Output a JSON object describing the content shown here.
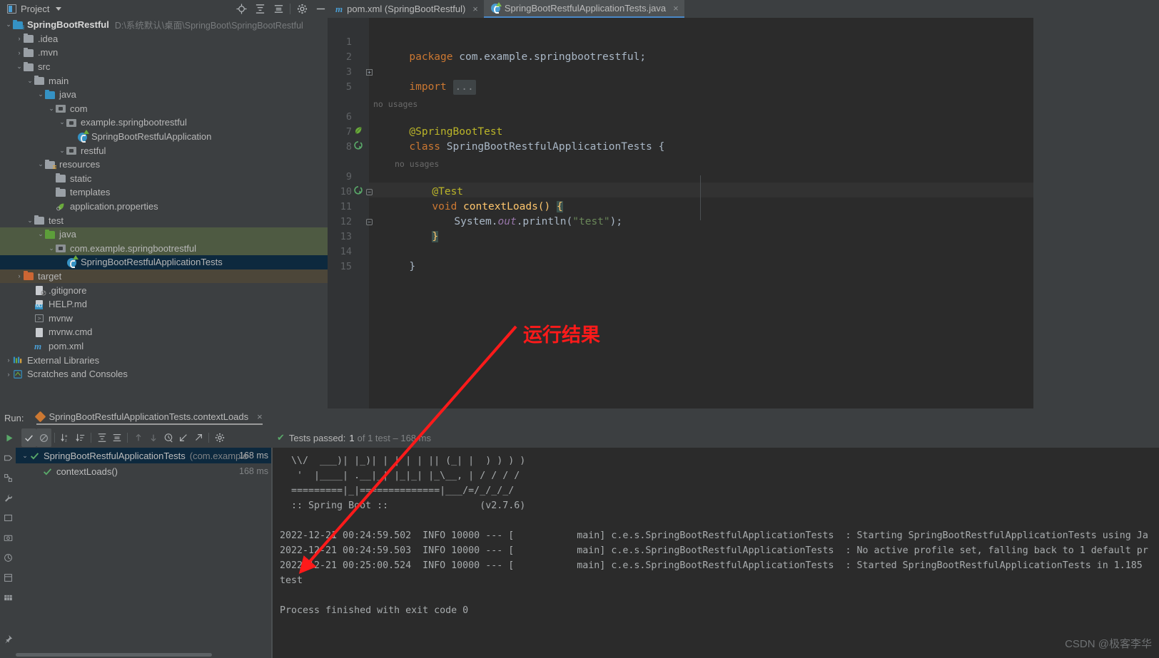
{
  "colors": {
    "accent_blue": "#4a88c7",
    "selection_blue": "#0d293e",
    "selection_green": "#4e5a42",
    "selection_brown": "#4c4639",
    "annotation_red": "#ff1a1a",
    "pass_green": "#59a869",
    "editor_bg": "#2b2b2b",
    "panel_bg": "#3c3f41"
  },
  "toolwindow": {
    "title": "Project",
    "icons": [
      "locate-icon",
      "expand-all-icon",
      "collapse-all-icon",
      "gear-icon",
      "minimize-icon"
    ]
  },
  "editor_tabs": [
    {
      "label": "pom.xml (SpringBootRestful)",
      "icon": "maven-icon",
      "active": false,
      "close": "×"
    },
    {
      "label": "SpringBootRestfulApplicationTests.java",
      "icon": "java-test-class-icon",
      "active": true,
      "close": "×"
    }
  ],
  "project_tree": [
    {
      "indent": 0,
      "arrow": "⌄",
      "icon": "module-folder-icon",
      "label": "SpringBootRestful",
      "path": "D:\\系统默认\\桌面\\SpringBoot\\SpringBootRestful",
      "bold": true,
      "select": "none"
    },
    {
      "indent": 1,
      "arrow": "›",
      "icon": "folder-icon",
      "label": ".idea",
      "path": "",
      "bold": false,
      "select": "none"
    },
    {
      "indent": 1,
      "arrow": "›",
      "icon": "folder-icon",
      "label": ".mvn",
      "path": "",
      "bold": false,
      "select": "none"
    },
    {
      "indent": 1,
      "arrow": "⌄",
      "icon": "folder-icon",
      "label": "src",
      "path": "",
      "bold": false,
      "select": "none"
    },
    {
      "indent": 2,
      "arrow": "⌄",
      "icon": "folder-icon",
      "label": "main",
      "path": "",
      "bold": false,
      "select": "none"
    },
    {
      "indent": 3,
      "arrow": "⌄",
      "icon": "source-folder-icon",
      "label": "java",
      "path": "",
      "bold": false,
      "select": "none"
    },
    {
      "indent": 4,
      "arrow": "⌄",
      "icon": "package-icon",
      "label": "com",
      "path": "",
      "bold": false,
      "select": "none"
    },
    {
      "indent": 5,
      "arrow": "⌄",
      "icon": "package-icon",
      "label": "example.springbootrestful",
      "path": "",
      "bold": false,
      "select": "none"
    },
    {
      "indent": 6,
      "arrow": "",
      "icon": "spring-class-icon",
      "label": "SpringBootRestfulApplication",
      "path": "",
      "bold": false,
      "select": "none"
    },
    {
      "indent": 5,
      "arrow": "⌄",
      "icon": "package-icon",
      "label": "restful",
      "path": "",
      "bold": false,
      "select": "none"
    },
    {
      "indent": 3,
      "arrow": "⌄",
      "icon": "resources-folder-icon",
      "label": "resources",
      "path": "",
      "bold": false,
      "select": "none"
    },
    {
      "indent": 4,
      "arrow": "",
      "icon": "folder-icon",
      "label": "static",
      "path": "",
      "bold": false,
      "select": "none"
    },
    {
      "indent": 4,
      "arrow": "",
      "icon": "folder-icon",
      "label": "templates",
      "path": "",
      "bold": false,
      "select": "none"
    },
    {
      "indent": 4,
      "arrow": "",
      "icon": "properties-file-icon",
      "label": "application.properties",
      "path": "",
      "bold": false,
      "select": "none"
    },
    {
      "indent": 2,
      "arrow": "⌄",
      "icon": "folder-icon",
      "label": "test",
      "path": "",
      "bold": false,
      "select": "none"
    },
    {
      "indent": 3,
      "arrow": "⌄",
      "icon": "test-source-folder-icon",
      "label": "java",
      "path": "",
      "bold": false,
      "select": "green"
    },
    {
      "indent": 4,
      "arrow": "⌄",
      "icon": "package-icon",
      "label": "com.example.springbootrestful",
      "path": "",
      "bold": false,
      "select": "green"
    },
    {
      "indent": 5,
      "arrow": "",
      "icon": "java-test-class-icon",
      "label": "SpringBootRestfulApplicationTests",
      "path": "",
      "bold": false,
      "select": "blue"
    },
    {
      "indent": 1,
      "arrow": "›",
      "icon": "excluded-folder-icon",
      "label": "target",
      "path": "",
      "bold": false,
      "select": "brown"
    },
    {
      "indent": 2,
      "arrow": "",
      "icon": "gitignore-file-icon",
      "label": ".gitignore",
      "path": "",
      "bold": false,
      "select": "none"
    },
    {
      "indent": 2,
      "arrow": "",
      "icon": "markdown-file-icon",
      "label": "HELP.md",
      "path": "",
      "bold": false,
      "select": "none"
    },
    {
      "indent": 2,
      "arrow": "",
      "icon": "shell-script-icon",
      "label": "mvnw",
      "path": "",
      "bold": false,
      "select": "none"
    },
    {
      "indent": 2,
      "arrow": "",
      "icon": "cmd-file-icon",
      "label": "mvnw.cmd",
      "path": "",
      "bold": false,
      "select": "none"
    },
    {
      "indent": 2,
      "arrow": "",
      "icon": "maven-icon",
      "label": "pom.xml",
      "path": "",
      "bold": false,
      "select": "none"
    },
    {
      "indent": 0,
      "arrow": "›",
      "icon": "external-libraries-icon",
      "label": "External Libraries",
      "path": "",
      "bold": false,
      "select": "none"
    },
    {
      "indent": 0,
      "arrow": "›",
      "icon": "scratches-icon",
      "label": "Scratches and Consoles",
      "path": "",
      "bold": false,
      "select": "none"
    }
  ],
  "code": {
    "lines": [
      {
        "num": "1",
        "gutter": "",
        "text": "package com.example.springbootrestful;"
      },
      {
        "num": "2",
        "gutter": "",
        "text": ""
      },
      {
        "num": "3",
        "gutter": "",
        "text": "import ..."
      },
      {
        "num": "5",
        "gutter": "",
        "text": ""
      },
      {
        "num": "",
        "gutter": "",
        "text": "no usages"
      },
      {
        "num": "6",
        "gutter": "spring-leaf-icon",
        "text": "@SpringBootTest"
      },
      {
        "num": "7",
        "gutter": "run-test-icon",
        "text": "class SpringBootRestfulApplicationTests {"
      },
      {
        "num": "8",
        "gutter": "",
        "text": ""
      },
      {
        "num": "",
        "gutter": "",
        "text": "no usages"
      },
      {
        "num": "9",
        "gutter": "",
        "text": "@Test"
      },
      {
        "num": "10",
        "gutter": "run-test-icon",
        "text": "void contextLoads() {"
      },
      {
        "num": "11",
        "gutter": "",
        "text": "System.out.println(\"test\");"
      },
      {
        "num": "12",
        "gutter": "",
        "text": "}"
      },
      {
        "num": "13",
        "gutter": "",
        "text": ""
      },
      {
        "num": "14",
        "gutter": "",
        "text": "}"
      },
      {
        "num": "15",
        "gutter": "",
        "text": ""
      }
    ],
    "tokens": {
      "package_kw": "package",
      "package_name": "com.example.springbootrestful;",
      "import_kw": "import",
      "import_fold": "...",
      "no_usages": "no usages",
      "ann_springboottest": "@SpringBootTest",
      "class_kw": "class",
      "class_name": "SpringBootRestfulApplicationTests",
      "open_brace": "{",
      "ann_test": "@Test",
      "void_kw": "void",
      "method_name": "contextLoads()",
      "sysout_system": "System.",
      "sysout_out": "out",
      "sysout_println": ".println(",
      "sysout_str": "\"test\"",
      "sysout_end": ");",
      "close_brace": "}"
    }
  },
  "run_panel": {
    "label": "Run:",
    "tab_title": "SpringBootRestfulApplicationTests.contextLoads",
    "tab_close": "×",
    "toolbar_icons": [
      "rerun-icon",
      "show-passed-icon",
      "hide-ignored-icon",
      "sort-alphabetically-icon",
      "sort-by-duration-icon",
      "expand-all-icon",
      "collapse-all-icon",
      "prev-failed-icon",
      "next-failed-icon",
      "history-icon",
      "import-tests-icon",
      "export-tests-icon",
      "settings-icon"
    ],
    "status": {
      "check": "✔",
      "main": "Tests passed:",
      "count": "1",
      "detail": "of 1 test – 168 ms"
    },
    "test_tree": [
      {
        "indent": 0,
        "arrow": "⌄",
        "status": "passed",
        "label": "SpringBootRestfulApplicationTests",
        "suffix": "(com.example",
        "ms": "168 ms",
        "selected": true
      },
      {
        "indent": 1,
        "arrow": "",
        "status": "passed",
        "label": "contextLoads()",
        "suffix": "",
        "ms": "168 ms",
        "selected": false
      }
    ],
    "console_lines": [
      "  \\\\/  ___)| |_)| | | | | || (_| |  ) ) ) )",
      "   '  |____| .__|_| |_|_| |_\\__, | / / / /",
      "  =========|_|==============|___/=/_/_/_/",
      "  :: Spring Boot ::                (v2.7.6)",
      "",
      "2022-12-21 00:24:59.502  INFO 10000 --- [           main] c.e.s.SpringBootRestfulApplicationTests  : Starting SpringBootRestfulApplicationTests using Ja",
      "2022-12-21 00:24:59.503  INFO 10000 --- [           main] c.e.s.SpringBootRestfulApplicationTests  : No active profile set, falling back to 1 default pr",
      "2022-12-21 00:25:00.524  INFO 10000 --- [           main] c.e.s.SpringBootRestfulApplicationTests  : Started SpringBootRestfulApplicationTests in 1.185",
      "test",
      "",
      "Process finished with exit code 0"
    ]
  },
  "annotation": {
    "text": "运行结果",
    "color": "#ff1a1a"
  },
  "watermark": {
    "text": "CSDN @极客李华"
  }
}
